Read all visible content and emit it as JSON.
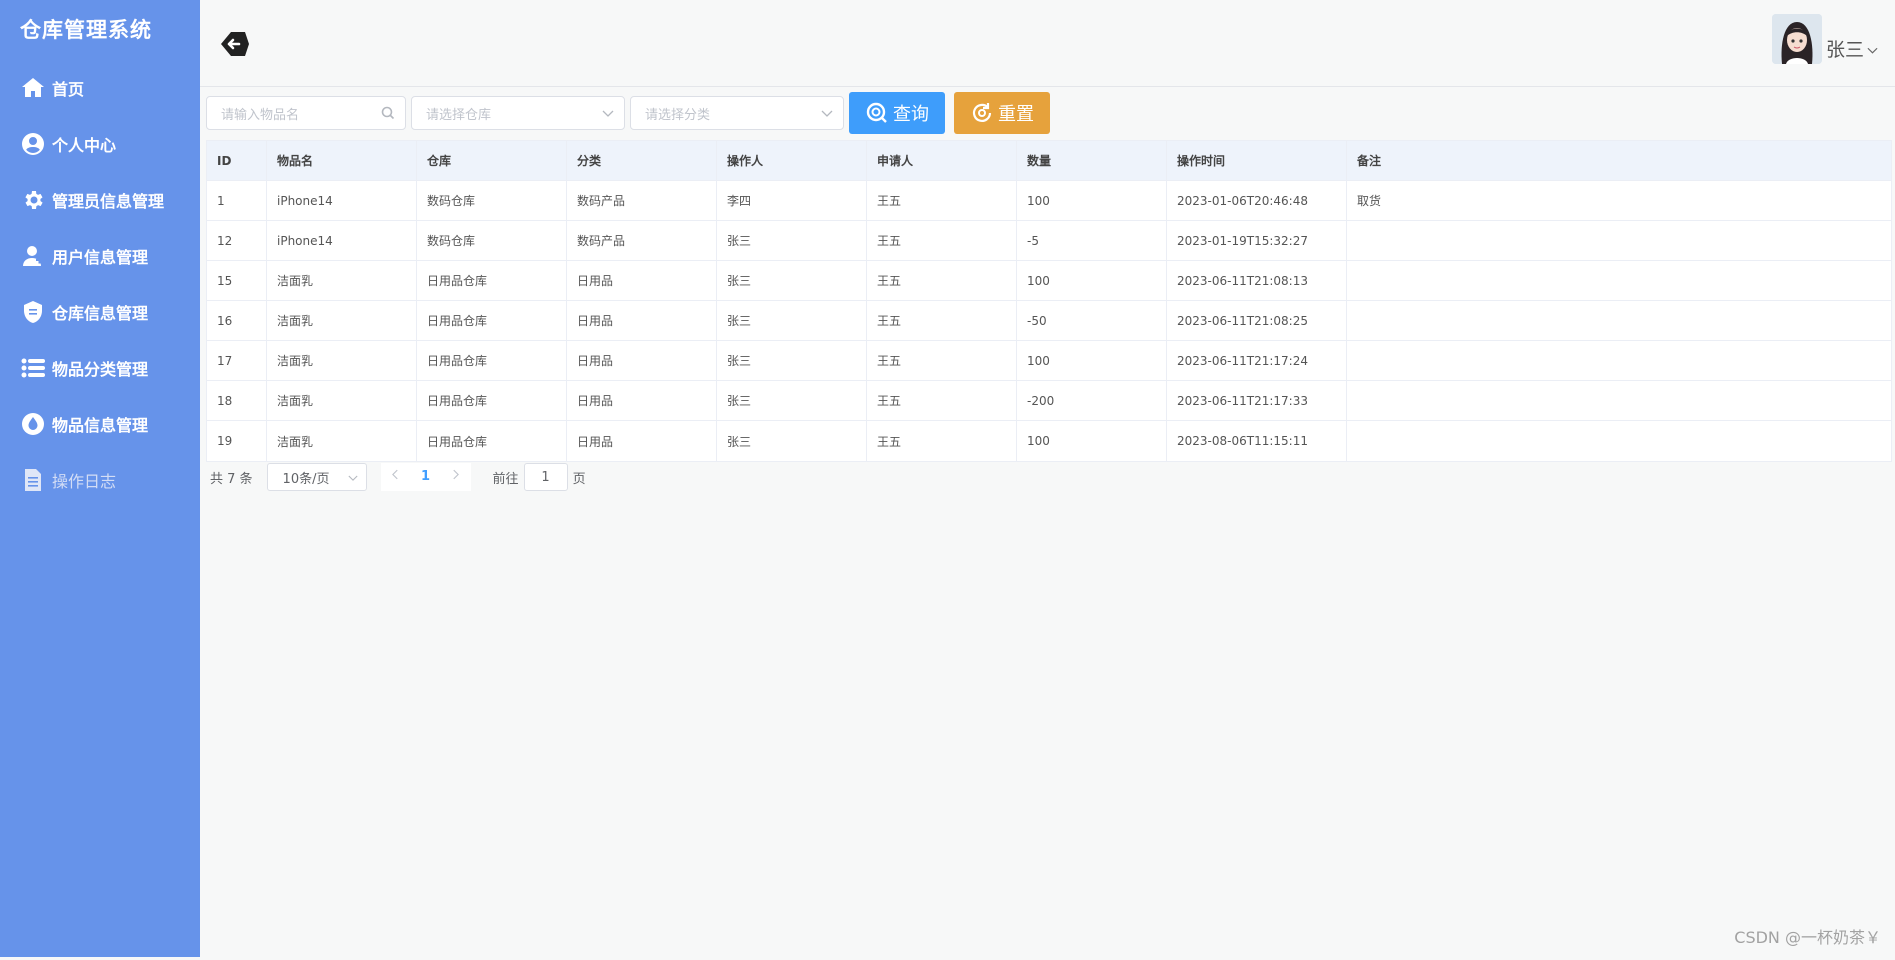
{
  "app": {
    "title": "仓库管理系统"
  },
  "sidebar": {
    "items": [
      {
        "label": "首页",
        "icon": "home-icon"
      },
      {
        "label": "个人中心",
        "icon": "user-circle-icon"
      },
      {
        "label": "管理员信息管理",
        "icon": "gear-icon"
      },
      {
        "label": "用户信息管理",
        "icon": "user-plus-icon"
      },
      {
        "label": "仓库信息管理",
        "icon": "shield-icon"
      },
      {
        "label": "物品分类管理",
        "icon": "list-icon"
      },
      {
        "label": "物品信息管理",
        "icon": "drop-icon"
      },
      {
        "label": "操作日志",
        "icon": "document-icon",
        "active": true
      }
    ]
  },
  "header": {
    "user_name": "张三"
  },
  "search": {
    "name_placeholder": "请输入物品名",
    "warehouse_placeholder": "请选择仓库",
    "category_placeholder": "请选择分类",
    "query_label": "查询",
    "reset_label": "重置"
  },
  "table": {
    "columns": [
      "ID",
      "物品名",
      "仓库",
      "分类",
      "操作人",
      "申请人",
      "数量",
      "操作时间",
      "备注"
    ],
    "rows": [
      [
        "1",
        "iPhone14",
        "数码仓库",
        "数码产品",
        "李四",
        "王五",
        "100",
        "2023-01-06T20:46:48",
        "取货"
      ],
      [
        "12",
        "iPhone14",
        "数码仓库",
        "数码产品",
        "张三",
        "王五",
        "-5",
        "2023-01-19T15:32:27",
        ""
      ],
      [
        "15",
        "洁面乳",
        "日用品仓库",
        "日用品",
        "张三",
        "王五",
        "100",
        "2023-06-11T21:08:13",
        ""
      ],
      [
        "16",
        "洁面乳",
        "日用品仓库",
        "日用品",
        "张三",
        "王五",
        "-50",
        "2023-06-11T21:08:25",
        ""
      ],
      [
        "17",
        "洁面乳",
        "日用品仓库",
        "日用品",
        "张三",
        "王五",
        "100",
        "2023-06-11T21:17:24",
        ""
      ],
      [
        "18",
        "洁面乳",
        "日用品仓库",
        "日用品",
        "张三",
        "王五",
        "-200",
        "2023-06-11T21:17:33",
        ""
      ],
      [
        "19",
        "洁面乳",
        "日用品仓库",
        "日用品",
        "张三",
        "王五",
        "100",
        "2023-08-06T11:15:11",
        ""
      ]
    ]
  },
  "pagination": {
    "total_text": "共 7 条",
    "page_size": "10条/页",
    "current_page": "1",
    "goto_label": "前往",
    "goto_value": "1",
    "page_suffix": "页"
  },
  "watermark": "CSDN @一杯奶茶￥",
  "colors": {
    "sidebar": "#6693ea",
    "primary": "#3e9dfb",
    "warning": "#e6a23c"
  }
}
